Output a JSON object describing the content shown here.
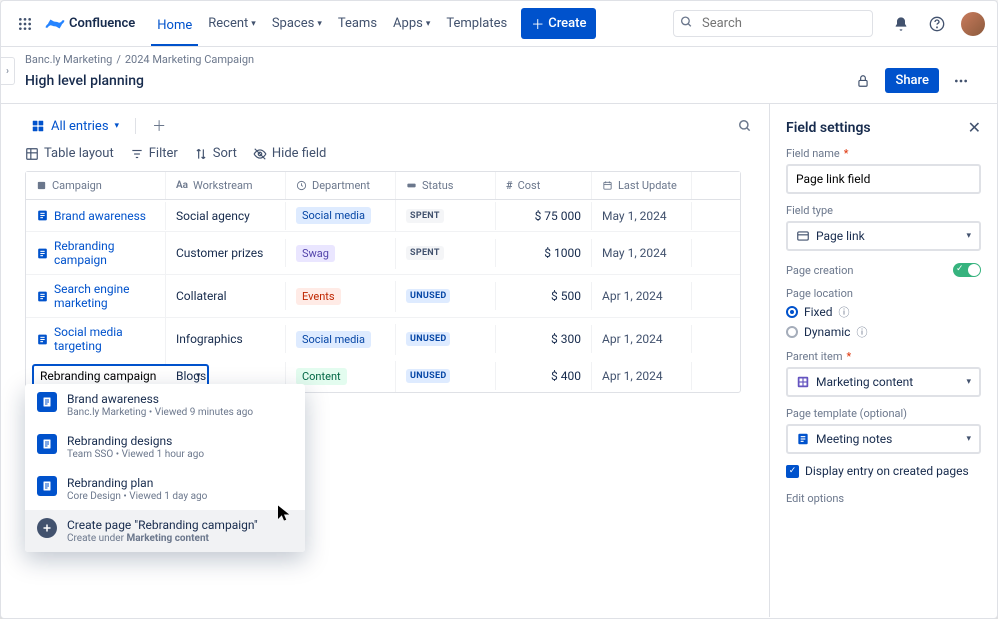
{
  "nav": {
    "product": "Confluence",
    "items": [
      "Home",
      "Recent",
      "Spaces",
      "Teams",
      "Apps",
      "Templates"
    ],
    "create": "Create",
    "search_placeholder": "Search"
  },
  "breadcrumb": {
    "space": "Banc.ly Marketing",
    "page": "2024 Marketing Campaign"
  },
  "page_title": "High level planning",
  "share": "Share",
  "view_tab": "All entries",
  "toolbar": {
    "layout": "Table layout",
    "filter": "Filter",
    "sort": "Sort",
    "hide": "Hide field"
  },
  "columns": [
    "Campaign",
    "Workstream",
    "Department",
    "Status",
    "Cost",
    "Last Update"
  ],
  "rows": [
    {
      "campaign": "Brand awareness",
      "workstream": "Social agency",
      "dept": "Social media",
      "dept_cls": "social",
      "status": "SPENT",
      "status_cls": "spent",
      "cost": "$ 75 000",
      "date": "May 1, 2024"
    },
    {
      "campaign": "Rebranding campaign",
      "workstream": "Customer prizes",
      "dept": "Swag",
      "dept_cls": "swag",
      "status": "SPENT",
      "status_cls": "spent",
      "cost": "$ 1000",
      "date": "May 1, 2024"
    },
    {
      "campaign": "Search engine marketing",
      "workstream": "Collateral",
      "dept": "Events",
      "dept_cls": "events",
      "status": "UNUSED",
      "status_cls": "unused",
      "cost": "$ 500",
      "date": "Apr 1, 2024"
    },
    {
      "campaign": "Social media targeting",
      "workstream": "Infographics",
      "dept": "Social media",
      "dept_cls": "social",
      "status": "UNUSED",
      "status_cls": "unused",
      "cost": "$ 300",
      "date": "Apr 1, 2024"
    }
  ],
  "editing_row": {
    "input": "Rebranding campaign",
    "workstream": "Blogs",
    "dept": "Content",
    "dept_cls": "content",
    "status": "UNUSED",
    "status_cls": "unused",
    "cost": "$ 400",
    "date": "Apr 1, 2024"
  },
  "suggestions": [
    {
      "title": "Brand awareness",
      "sub": "Banc.ly Marketing   •   Viewed 9 minutes ago"
    },
    {
      "title": "Rebranding designs",
      "sub": "Team SSO   •   Viewed 1 hour ago"
    },
    {
      "title": "Rebranding plan",
      "sub": "Core Design   •   Viewed 1 day ago"
    }
  ],
  "create_suggest": {
    "title": "Create page \"Rebranding campaign\"",
    "sub_pre": "Create under ",
    "sub_bold": "Marketing content"
  },
  "panel": {
    "title": "Field settings",
    "field_name_lbl": "Field name",
    "field_name_val": "Page link field",
    "field_type_lbl": "Field type",
    "field_type_val": "Page link",
    "page_creation_lbl": "Page creation",
    "page_location_lbl": "Page location",
    "loc_fixed": "Fixed",
    "loc_dynamic": "Dynamic",
    "parent_item_lbl": "Parent item",
    "parent_item_val": "Marketing content",
    "template_lbl": "Page template (optional)",
    "template_val": "Meeting notes",
    "display_entry": "Display entry on created pages",
    "edit_options": "Edit options"
  }
}
